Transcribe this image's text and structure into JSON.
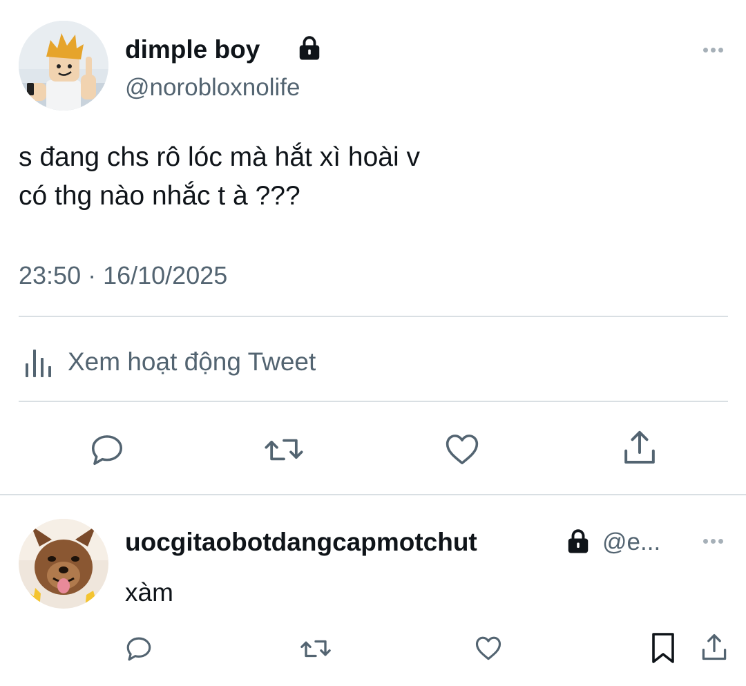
{
  "tweet": {
    "author": {
      "display_name": "dimple boy",
      "handle": "@norobloxnolife",
      "avatar": "roblox-character-avatar",
      "protected": true
    },
    "text_lines": [
      "s đang chs rô lóc mà hắt xì hoài v",
      "có thg nào nhắc t à ???"
    ],
    "timestamp": "23:50 · 16/10/2025",
    "activity_label": "Xem hoạt động Tweet",
    "actions": [
      "reply-icon",
      "retweet-icon",
      "like-icon",
      "share-icon"
    ]
  },
  "reply": {
    "author": {
      "display_name": "uocgitaobotdangcapmotchut",
      "handle": "@e...",
      "avatar": "dog-avatar",
      "protected": true
    },
    "text": "xàm",
    "actions": [
      "reply-icon",
      "retweet-icon",
      "like-icon",
      "bookmark-icon",
      "share-icon"
    ]
  },
  "colors": {
    "primary_text": "#0f1419",
    "secondary_text": "#536471",
    "divider": "#d9dfe3",
    "icon": "#536471"
  }
}
